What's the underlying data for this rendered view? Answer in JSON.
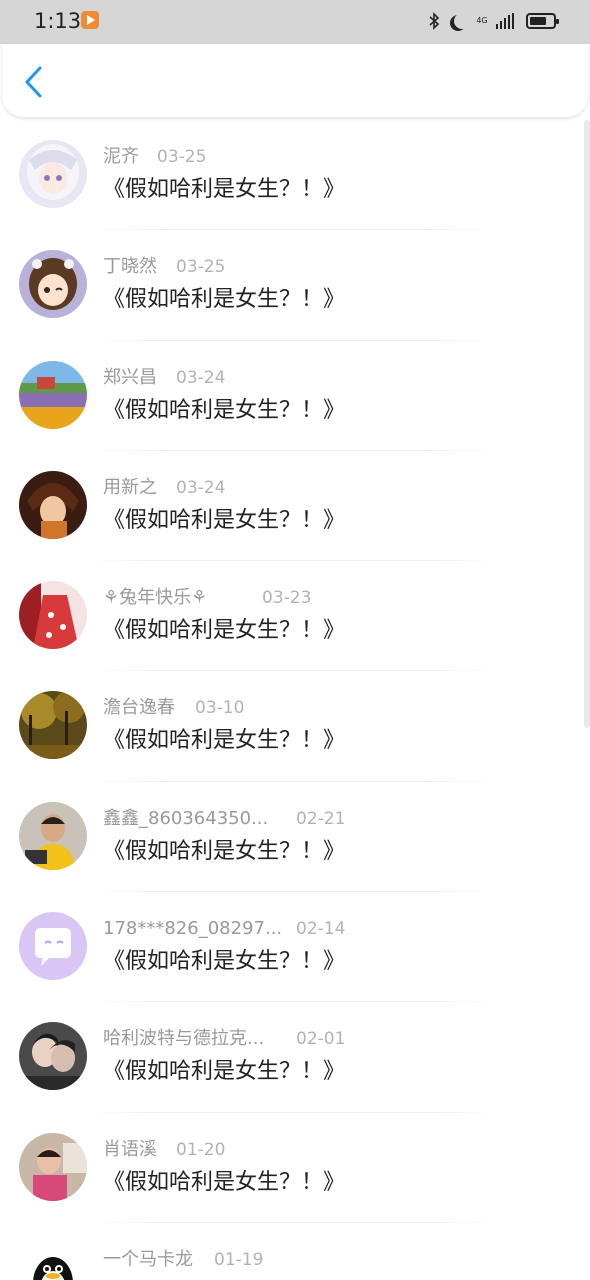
{
  "status_bar": {
    "time": "1:13",
    "network": "4G"
  },
  "items": [
    {
      "name": "泥齐",
      "date": "03-25",
      "comment": "《假如哈利是女生？！》",
      "avatar": "anime-girl-white-hair"
    },
    {
      "name": "丁晓然",
      "date": "03-25",
      "comment": "《假如哈利是女生？！》",
      "avatar": "anime-girl-wink"
    },
    {
      "name": "郑兴昌",
      "date": "03-24",
      "comment": "《假如哈利是女生？！》",
      "avatar": "landscape-field"
    },
    {
      "name": "用新之",
      "date": "03-24",
      "comment": "《假如哈利是女生？！》",
      "avatar": "anime-boy"
    },
    {
      "name": "⚘兔年快乐⚘",
      "date": "03-23",
      "comment": "《假如哈利是女生？！》",
      "avatar": "red-dress"
    },
    {
      "name": "澹台逸春",
      "date": "03-10",
      "comment": "《假如哈利是女生？！》",
      "avatar": "autumn-forest"
    },
    {
      "name": "鑫鑫_860364350...",
      "date": "02-21",
      "comment": "《假如哈利是女生？！》",
      "avatar": "man-photo"
    },
    {
      "name": "178***826_08297...",
      "date": "02-14",
      "comment": "《假如哈利是女生？！》",
      "avatar": "default-chat"
    },
    {
      "name": "哈利波特与德拉克...",
      "date": "02-01",
      "comment": "《假如哈利是女生？！》",
      "avatar": "couple-photo"
    },
    {
      "name": "肖语溪",
      "date": "01-20",
      "comment": "《假如哈利是女生？！》",
      "avatar": "child-photo"
    },
    {
      "name": "一个马卡龙",
      "date": "01-19",
      "comment": "",
      "avatar": "qq-penguin"
    }
  ],
  "colors": {
    "accent": "#2196f3",
    "status_bar_bg": "#d6d6d6",
    "name": "#9a9a9a",
    "comment": "#222222",
    "default_avatar": "#d9c6f5"
  }
}
